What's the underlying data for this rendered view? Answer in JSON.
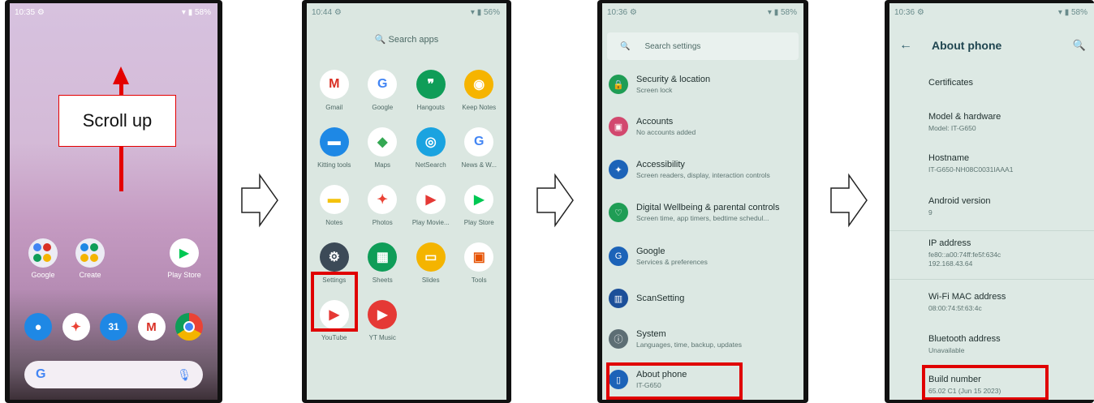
{
  "step1": {
    "time": "10:35",
    "battery": "58%",
    "instruction": "Scroll up",
    "apps": [
      {
        "label": "Google",
        "icon": "folder-icon"
      },
      {
        "label": "Create",
        "icon": "folder-icon"
      },
      {
        "label": "Play Store",
        "icon": "play-store-icon"
      }
    ],
    "dock": [
      "contacts-icon",
      "photos-icon",
      "calendar-icon",
      "gmail-icon",
      "chrome-icon"
    ],
    "calendar_day": "31",
    "search_glyph": "G"
  },
  "step2": {
    "time": "10:44",
    "battery": "56%",
    "search_placeholder": "Search apps",
    "apps": [
      {
        "label": "Gmail",
        "glyph": "M",
        "bg": "#ffffff",
        "fg": "#d93025"
      },
      {
        "label": "Google",
        "glyph": "G",
        "bg": "#ffffff",
        "fg": "#4285f4"
      },
      {
        "label": "Hangouts",
        "glyph": "❞",
        "bg": "#0f9d58",
        "fg": "#ffffff"
      },
      {
        "label": "Keep Notes",
        "glyph": "◉",
        "bg": "#f6b400",
        "fg": "#ffffff"
      },
      {
        "label": "Kitting tools",
        "glyph": "▬",
        "bg": "#1e88e5",
        "fg": "#ffffff"
      },
      {
        "label": "Maps",
        "glyph": "◆",
        "bg": "#ffffff",
        "fg": "#34a853"
      },
      {
        "label": "NetSearch",
        "glyph": "◎",
        "bg": "#1aa3e0",
        "fg": "#ffffff"
      },
      {
        "label": "News & W...",
        "glyph": "G",
        "bg": "#ffffff",
        "fg": "#4285f4"
      },
      {
        "label": "Notes",
        "glyph": "▬",
        "bg": "#ffffff",
        "fg": "#f4c20d"
      },
      {
        "label": "Photos",
        "glyph": "✦",
        "bg": "#ffffff",
        "fg": "#ea4335"
      },
      {
        "label": "Play Movie...",
        "glyph": "▶",
        "bg": "#ffffff",
        "fg": "#e53935"
      },
      {
        "label": "Play Store",
        "glyph": "▶",
        "bg": "#ffffff",
        "fg": "#00c853"
      },
      {
        "label": "Settings",
        "glyph": "⚙",
        "bg": "#3c4a57",
        "fg": "#ffffff"
      },
      {
        "label": "Sheets",
        "glyph": "▦",
        "bg": "#0f9d58",
        "fg": "#ffffff"
      },
      {
        "label": "Slides",
        "glyph": "▭",
        "bg": "#f4b400",
        "fg": "#ffffff"
      },
      {
        "label": "Tools",
        "glyph": "▣",
        "bg": "#ffffff",
        "fg": "#e65100"
      },
      {
        "label": "YouTube",
        "glyph": "▶",
        "bg": "#ffffff",
        "fg": "#e53935"
      },
      {
        "label": "YT Music",
        "glyph": "▶",
        "bg": "#e53935",
        "fg": "#ffffff"
      }
    ]
  },
  "step3": {
    "time": "10:36",
    "battery": "58%",
    "search_placeholder": "Search settings",
    "items": [
      {
        "title": "Security & location",
        "sub": "Screen lock",
        "color": "#1f9d55",
        "glyph": "🔒"
      },
      {
        "title": "Accounts",
        "sub": "No accounts added",
        "color": "#d2486e",
        "glyph": "▣"
      },
      {
        "title": "Accessibility",
        "sub": "Screen readers, display, interaction controls",
        "color": "#1c63b8",
        "glyph": "✦"
      },
      {
        "title": "Digital Wellbeing & parental controls",
        "sub": "Screen time, app timers, bedtime schedul...",
        "color": "#1f9d55",
        "glyph": "♡"
      },
      {
        "title": "Google",
        "sub": "Services & preferences",
        "color": "#1c63b8",
        "glyph": "G"
      },
      {
        "title": "ScanSetting",
        "sub": "",
        "color": "#1c4f99",
        "glyph": "▥"
      },
      {
        "title": "System",
        "sub": "Languages, time, backup, updates",
        "color": "#5d6e74",
        "glyph": "ⓘ"
      },
      {
        "title": "About phone",
        "sub": "IT-G650",
        "color": "#1c63b8",
        "glyph": "▯"
      }
    ]
  },
  "step4": {
    "time": "10:36",
    "battery": "58%",
    "title": "About phone",
    "items": [
      {
        "label": "Certificates",
        "value": ""
      },
      {
        "label": "Model & hardware",
        "value": "Model: IT-G650"
      },
      {
        "label": "Hostname",
        "value": "IT-G650-NH08C0031IAAA1"
      },
      {
        "label": "Android version",
        "value": "9"
      },
      {
        "label": "IP address",
        "value": "fe80::a00:74ff:fe5f:634c\n192.168.43.64"
      },
      {
        "label": "Wi-Fi MAC address",
        "value": "08:00:74:5f:63:4c"
      },
      {
        "label": "Bluetooth address",
        "value": "Unavailable"
      },
      {
        "label": "Build number",
        "value": "65.02 C1 (Jun 15 2023)"
      }
    ]
  }
}
